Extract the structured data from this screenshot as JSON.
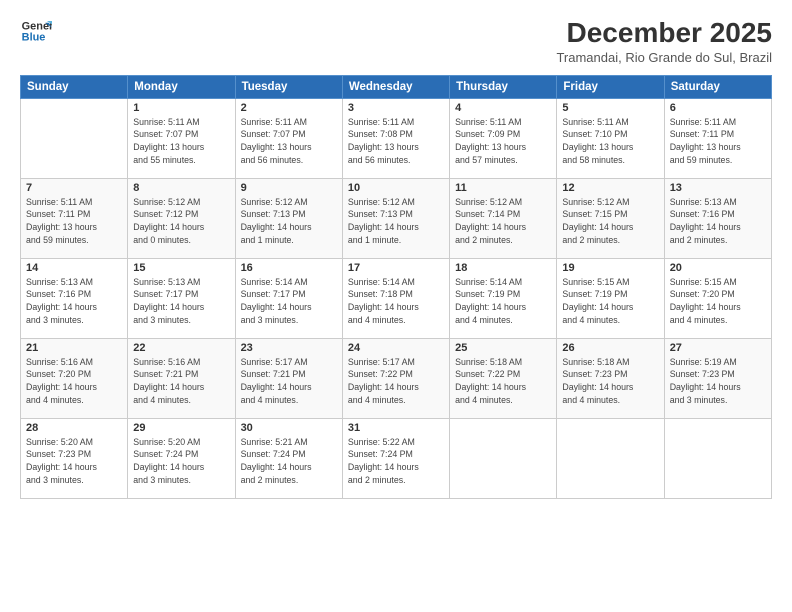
{
  "logo": {
    "line1": "General",
    "line2": "Blue"
  },
  "title": "December 2025",
  "subtitle": "Tramandai, Rio Grande do Sul, Brazil",
  "days_header": [
    "Sunday",
    "Monday",
    "Tuesday",
    "Wednesday",
    "Thursday",
    "Friday",
    "Saturday"
  ],
  "weeks": [
    [
      {
        "day": "",
        "info": ""
      },
      {
        "day": "1",
        "info": "Sunrise: 5:11 AM\nSunset: 7:07 PM\nDaylight: 13 hours\nand 55 minutes."
      },
      {
        "day": "2",
        "info": "Sunrise: 5:11 AM\nSunset: 7:07 PM\nDaylight: 13 hours\nand 56 minutes."
      },
      {
        "day": "3",
        "info": "Sunrise: 5:11 AM\nSunset: 7:08 PM\nDaylight: 13 hours\nand 56 minutes."
      },
      {
        "day": "4",
        "info": "Sunrise: 5:11 AM\nSunset: 7:09 PM\nDaylight: 13 hours\nand 57 minutes."
      },
      {
        "day": "5",
        "info": "Sunrise: 5:11 AM\nSunset: 7:10 PM\nDaylight: 13 hours\nand 58 minutes."
      },
      {
        "day": "6",
        "info": "Sunrise: 5:11 AM\nSunset: 7:11 PM\nDaylight: 13 hours\nand 59 minutes."
      }
    ],
    [
      {
        "day": "7",
        "info": "Sunrise: 5:11 AM\nSunset: 7:11 PM\nDaylight: 13 hours\nand 59 minutes."
      },
      {
        "day": "8",
        "info": "Sunrise: 5:12 AM\nSunset: 7:12 PM\nDaylight: 14 hours\nand 0 minutes."
      },
      {
        "day": "9",
        "info": "Sunrise: 5:12 AM\nSunset: 7:13 PM\nDaylight: 14 hours\nand 1 minute."
      },
      {
        "day": "10",
        "info": "Sunrise: 5:12 AM\nSunset: 7:13 PM\nDaylight: 14 hours\nand 1 minute."
      },
      {
        "day": "11",
        "info": "Sunrise: 5:12 AM\nSunset: 7:14 PM\nDaylight: 14 hours\nand 2 minutes."
      },
      {
        "day": "12",
        "info": "Sunrise: 5:12 AM\nSunset: 7:15 PM\nDaylight: 14 hours\nand 2 minutes."
      },
      {
        "day": "13",
        "info": "Sunrise: 5:13 AM\nSunset: 7:16 PM\nDaylight: 14 hours\nand 2 minutes."
      }
    ],
    [
      {
        "day": "14",
        "info": "Sunrise: 5:13 AM\nSunset: 7:16 PM\nDaylight: 14 hours\nand 3 minutes."
      },
      {
        "day": "15",
        "info": "Sunrise: 5:13 AM\nSunset: 7:17 PM\nDaylight: 14 hours\nand 3 minutes."
      },
      {
        "day": "16",
        "info": "Sunrise: 5:14 AM\nSunset: 7:17 PM\nDaylight: 14 hours\nand 3 minutes."
      },
      {
        "day": "17",
        "info": "Sunrise: 5:14 AM\nSunset: 7:18 PM\nDaylight: 14 hours\nand 4 minutes."
      },
      {
        "day": "18",
        "info": "Sunrise: 5:14 AM\nSunset: 7:19 PM\nDaylight: 14 hours\nand 4 minutes."
      },
      {
        "day": "19",
        "info": "Sunrise: 5:15 AM\nSunset: 7:19 PM\nDaylight: 14 hours\nand 4 minutes."
      },
      {
        "day": "20",
        "info": "Sunrise: 5:15 AM\nSunset: 7:20 PM\nDaylight: 14 hours\nand 4 minutes."
      }
    ],
    [
      {
        "day": "21",
        "info": "Sunrise: 5:16 AM\nSunset: 7:20 PM\nDaylight: 14 hours\nand 4 minutes."
      },
      {
        "day": "22",
        "info": "Sunrise: 5:16 AM\nSunset: 7:21 PM\nDaylight: 14 hours\nand 4 minutes."
      },
      {
        "day": "23",
        "info": "Sunrise: 5:17 AM\nSunset: 7:21 PM\nDaylight: 14 hours\nand 4 minutes."
      },
      {
        "day": "24",
        "info": "Sunrise: 5:17 AM\nSunset: 7:22 PM\nDaylight: 14 hours\nand 4 minutes."
      },
      {
        "day": "25",
        "info": "Sunrise: 5:18 AM\nSunset: 7:22 PM\nDaylight: 14 hours\nand 4 minutes."
      },
      {
        "day": "26",
        "info": "Sunrise: 5:18 AM\nSunset: 7:23 PM\nDaylight: 14 hours\nand 4 minutes."
      },
      {
        "day": "27",
        "info": "Sunrise: 5:19 AM\nSunset: 7:23 PM\nDaylight: 14 hours\nand 3 minutes."
      }
    ],
    [
      {
        "day": "28",
        "info": "Sunrise: 5:20 AM\nSunset: 7:23 PM\nDaylight: 14 hours\nand 3 minutes."
      },
      {
        "day": "29",
        "info": "Sunrise: 5:20 AM\nSunset: 7:24 PM\nDaylight: 14 hours\nand 3 minutes."
      },
      {
        "day": "30",
        "info": "Sunrise: 5:21 AM\nSunset: 7:24 PM\nDaylight: 14 hours\nand 2 minutes."
      },
      {
        "day": "31",
        "info": "Sunrise: 5:22 AM\nSunset: 7:24 PM\nDaylight: 14 hours\nand 2 minutes."
      },
      {
        "day": "",
        "info": ""
      },
      {
        "day": "",
        "info": ""
      },
      {
        "day": "",
        "info": ""
      }
    ]
  ]
}
